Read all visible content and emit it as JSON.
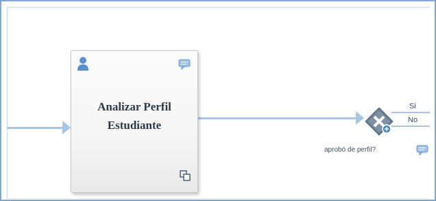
{
  "diagram": {
    "task": {
      "title": "Analizar Perfil\nEstudiante",
      "type_icon": "user-icon",
      "comment_icon": "comment-icon",
      "marker_icon": "multi-instance-icon"
    },
    "gateway": {
      "icon": "exclusive-gateway-icon",
      "label": "aprobó de perfil?",
      "comment_icon": "comment-icon"
    },
    "flows": [
      {
        "label": "Si"
      },
      {
        "label": "No"
      }
    ],
    "colors": {
      "connector": "#a9c4e6",
      "frame": "#7fa6cf",
      "task_text": "#2b3a4a",
      "user_icon": "#5a8fd0",
      "gateway": "#5b6f83"
    }
  }
}
